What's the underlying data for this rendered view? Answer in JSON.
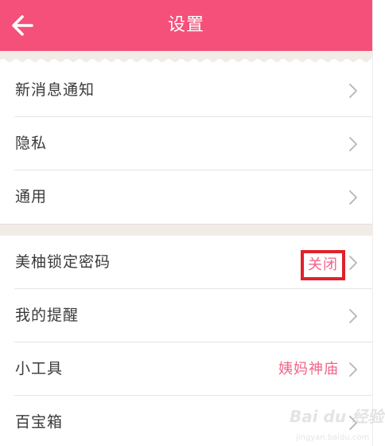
{
  "header": {
    "title": "设置",
    "back_icon": "arrow-left-icon",
    "bg_color": "#f4507a"
  },
  "groups": [
    {
      "items": [
        {
          "label": "新消息通知",
          "value": ""
        },
        {
          "label": "隐私",
          "value": ""
        },
        {
          "label": "通用",
          "value": ""
        }
      ]
    },
    {
      "items": [
        {
          "label": "美柚锁定密码",
          "value": "关闭",
          "highlighted": true
        },
        {
          "label": "我的提醒",
          "value": ""
        },
        {
          "label": "小工具",
          "value": "姨妈神庙"
        },
        {
          "label": "百宝箱",
          "value": ""
        }
      ]
    }
  ],
  "watermark": {
    "text": "Bai du 经验",
    "url_text": "jingyan.baidu.com"
  },
  "colors": {
    "accent": "#f4507a",
    "value_text": "#f1648a",
    "highlight_border": "#e0212b"
  }
}
